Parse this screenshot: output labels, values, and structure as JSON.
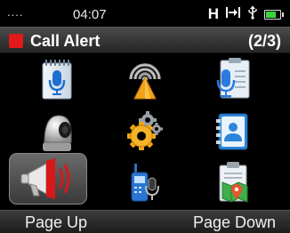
{
  "status": {
    "signal": "....",
    "time": "04:07",
    "mode_letter": "H",
    "battery_level": 0.8
  },
  "header": {
    "title": "Call Alert",
    "page": "(2/3)",
    "indicator_color": "#e01a1a"
  },
  "menu": {
    "items": [
      {
        "icon": "voice-note-icon"
      },
      {
        "icon": "scan-signal-icon"
      },
      {
        "icon": "voice-record-notes-icon"
      },
      {
        "icon": "camera-icon"
      },
      {
        "icon": "settings-gear-icon"
      },
      {
        "icon": "contacts-icon"
      },
      {
        "icon": "call-alert-megaphone-icon",
        "selected": true
      },
      {
        "icon": "radio-voice-icon"
      },
      {
        "icon": "clipboard-map-icon"
      }
    ]
  },
  "softkeys": {
    "left": "Page Up",
    "right": "Page Down"
  }
}
